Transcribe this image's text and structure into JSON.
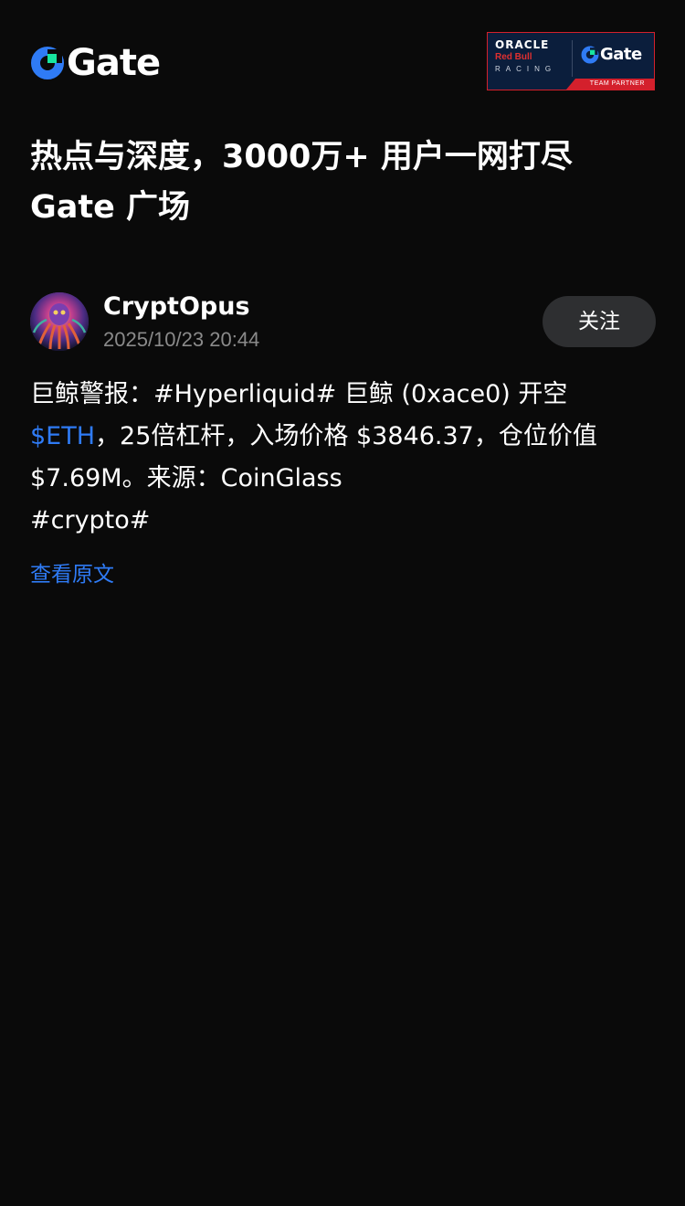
{
  "header": {
    "logo_text": "Gate",
    "partner_badge": {
      "oracle": "ORACLE",
      "red_bull": "Red Bull",
      "racing": "RACING",
      "gate": "Gate",
      "footer": "TEAM PARTNER"
    }
  },
  "headline": {
    "line1": "热点与深度，3000万+ 用户一网打尽",
    "line2": "Gate 广场"
  },
  "post": {
    "author": "CryptOpus",
    "timestamp": "2025/10/23 20:44",
    "follow_label": "关注",
    "body_part1": "巨鲸警报：#Hyperliquid# 巨鲸 (0xace0) 开空",
    "ticker": "$ETH",
    "body_part2": "，25倍杠杆，入场价格 $3846.37，仓位价值 $7.69M。来源：CoinGlass",
    "hashtag": "#crypto#",
    "view_original": "查看原文"
  },
  "colors": {
    "background": "#0a0a0a",
    "accent_blue": "#2f7bf5",
    "muted_text": "#8a8a8a",
    "button_bg": "#2e2f31",
    "badge_red": "#d4202c",
    "badge_navy": "#0b1e3c"
  },
  "icons": {
    "logo": "gate-logo-icon",
    "avatar": "octopus-avatar-image"
  }
}
